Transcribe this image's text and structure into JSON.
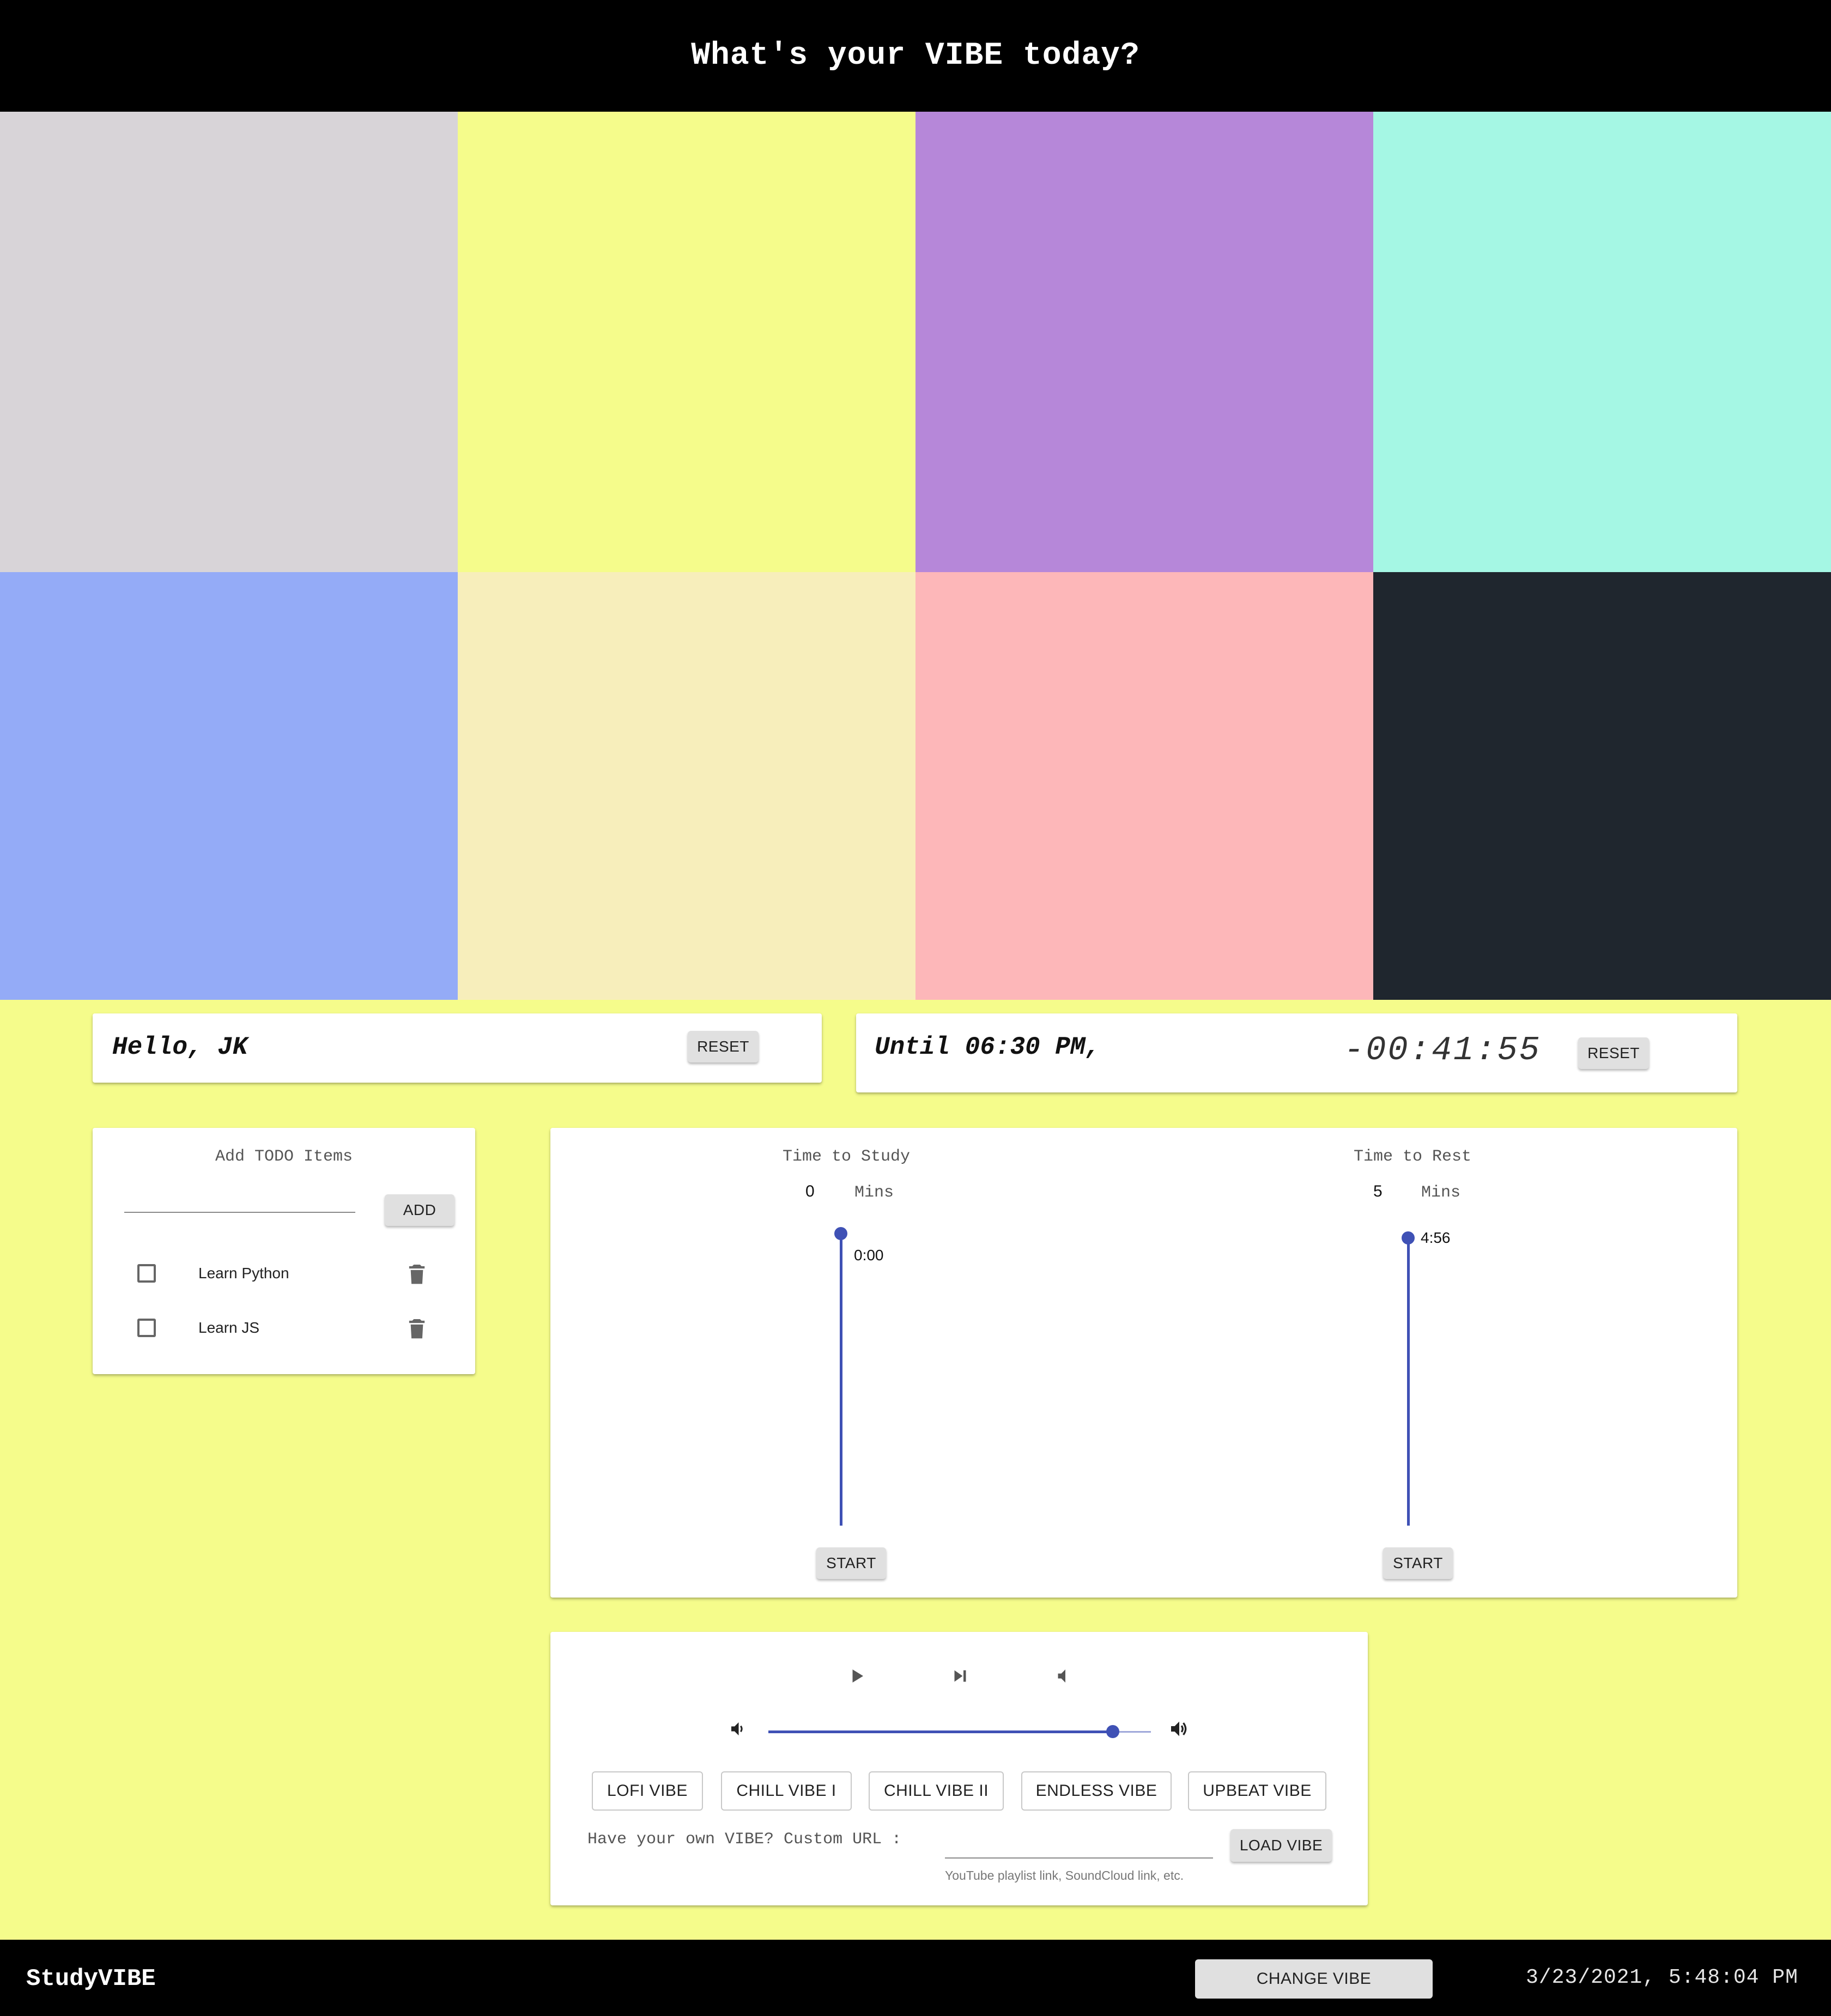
{
  "header": {
    "title": "What's your VIBE today?"
  },
  "swatches": [
    {
      "color": "#d8d4d8"
    },
    {
      "color": "#f5fc8b"
    },
    {
      "color": "#b687d9"
    },
    {
      "color": "#a5f7e4"
    },
    {
      "color": "#94abf7"
    },
    {
      "color": "#f7eebb"
    },
    {
      "color": "#fdb7b9"
    },
    {
      "color": "#1f262e"
    }
  ],
  "greeting": {
    "text": "Hello, JK",
    "reset_label": "RESET"
  },
  "deadline": {
    "until_text": "Until 06:30 PM,",
    "countdown": "-00:41:55",
    "reset_label": "RESET"
  },
  "todo": {
    "title": "Add TODO Items",
    "add_label": "ADD",
    "input_value": "",
    "items": [
      {
        "label": "Learn Python",
        "checked": false
      },
      {
        "label": "Learn JS",
        "checked": false
      }
    ]
  },
  "timers": {
    "study": {
      "title": "Time to Study",
      "value": "0",
      "unit": "Mins",
      "remaining": "0:00",
      "start_label": "START"
    },
    "rest": {
      "title": "Time to Rest",
      "value": "5",
      "unit": "Mins",
      "remaining": "4:56",
      "start_label": "START"
    }
  },
  "player": {
    "volume": 0.9,
    "vibes": [
      "LOFI VIBE",
      "CHILL VIBE I",
      "CHILL VIBE II",
      "ENDLESS VIBE",
      "UPBEAT VIBE"
    ],
    "custom_label": "Have your own VIBE? Custom URL :",
    "custom_value": "",
    "custom_helper": "YouTube playlist link, SoundCloud link, etc.",
    "load_label": "LOAD VIBE",
    "icons": [
      "play-icon",
      "skip-next-icon",
      "volume-mute-icon",
      "volume-down-icon",
      "volume-up-icon"
    ]
  },
  "footer": {
    "brand": "StudyVIBE",
    "change_label": "CHANGE VIBE",
    "datetime": "3/23/2021, 5:48:04 PM"
  },
  "colors": {
    "accent": "#3f51b5",
    "background": "#f5fc8b"
  }
}
